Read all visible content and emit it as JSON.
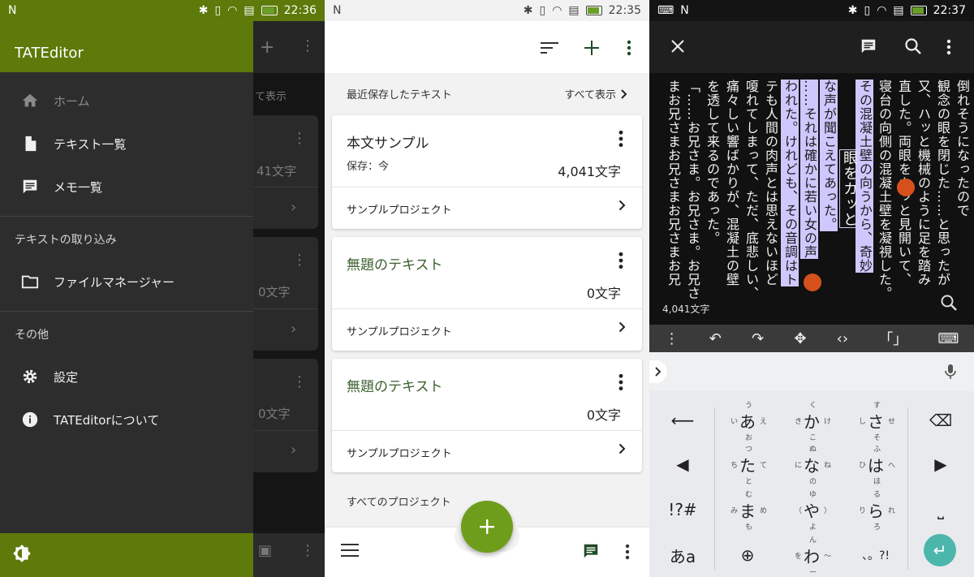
{
  "status": {
    "p1_time": "22:36",
    "p2_time": "22:35",
    "p3_time": "22:37"
  },
  "drawer": {
    "app_title": "TATEditor",
    "items": [
      {
        "label": "ホーム",
        "icon": "home-icon"
      },
      {
        "label": "テキスト一覧",
        "icon": "document-icon"
      },
      {
        "label": "メモ一覧",
        "icon": "memo-icon"
      },
      {
        "label": "ファイルマネージャー",
        "icon": "folder-icon"
      },
      {
        "label": "設定",
        "icon": "gear-icon"
      },
      {
        "label": "TATEditorについて",
        "icon": "info-icon"
      }
    ],
    "sections": {
      "import": "テキストの取り込み",
      "other": "その他"
    }
  },
  "background_list": {
    "show_all_partial": "て表示",
    "counts": [
      "41文字",
      "0文字",
      "0文字"
    ]
  },
  "textlist": {
    "recent_header": "最近保存したテキスト",
    "show_all": "すべて表示",
    "cards": [
      {
        "title": "本文サンプル",
        "saved": "保存：今",
        "count": "4,041文字",
        "project": "サンプルプロジェクト"
      },
      {
        "title": "無題のテキスト",
        "saved": "",
        "count": "0文字",
        "project": "サンプルプロジェクト"
      },
      {
        "title": "無題のテキスト",
        "saved": "",
        "count": "0文字",
        "project": "サンプルプロジェクト"
      }
    ],
    "all_projects": "すべてのプロジェクト"
  },
  "editor": {
    "char_count": "4,041文字",
    "columns": [
      "倒れそうになったので",
      "観念の眼を閉じた……と思ったが",
      "又、ハッと機械のように足を踏み",
      "直した。両眼をカッと見開いて、",
      "寝台の向側の混凝土壁を凝視した。",
      "その混凝土壁の向うから、奇妙",
      "眼をカッと",
      "な声が聞こえてあった。",
      "……それは確かに若い女の声",
      "われた。けれども、その音調はト",
      "テも人間の肉声とは思えないほど",
      "嗄れてしまって、ただ、底悲しい、",
      "痛々しい響ばかりが、混凝土の壁",
      "を透して来るのであった。",
      "「……お兄さま。お兄さま。お兄さ",
      "まお兄さまお兄さまお兄さまお兄"
    ]
  },
  "keyboard": {
    "rows": [
      [
        "あ",
        "か",
        "さ"
      ],
      [
        "た",
        "な",
        "は"
      ],
      [
        "ま",
        "や",
        "ら"
      ],
      [
        "わ"
      ]
    ],
    "subs": {
      "あ": [
        "う",
        "い",
        "え",
        "お"
      ],
      "か": [
        "く",
        "き",
        "け",
        "こ"
      ],
      "さ": [
        "す",
        "し",
        "せ",
        "そ"
      ],
      "た": [
        "つ",
        "ち",
        "て",
        "と"
      ],
      "な": [
        "ぬ",
        "に",
        "ね",
        "の"
      ],
      "は": [
        "ふ",
        "ひ",
        "へ",
        "ほ"
      ],
      "ま": [
        "む",
        "み",
        "め",
        "も"
      ],
      "や": [
        "ゆ",
        "（",
        "）",
        "よ"
      ],
      "ら": [
        "る",
        "り",
        "れ",
        "ろ"
      ],
      "わ": [
        "ん",
        "を",
        "〜",
        "ー"
      ]
    },
    "symbols": "!?#",
    "kana_switch": "あa",
    "punct": "、。?!"
  }
}
